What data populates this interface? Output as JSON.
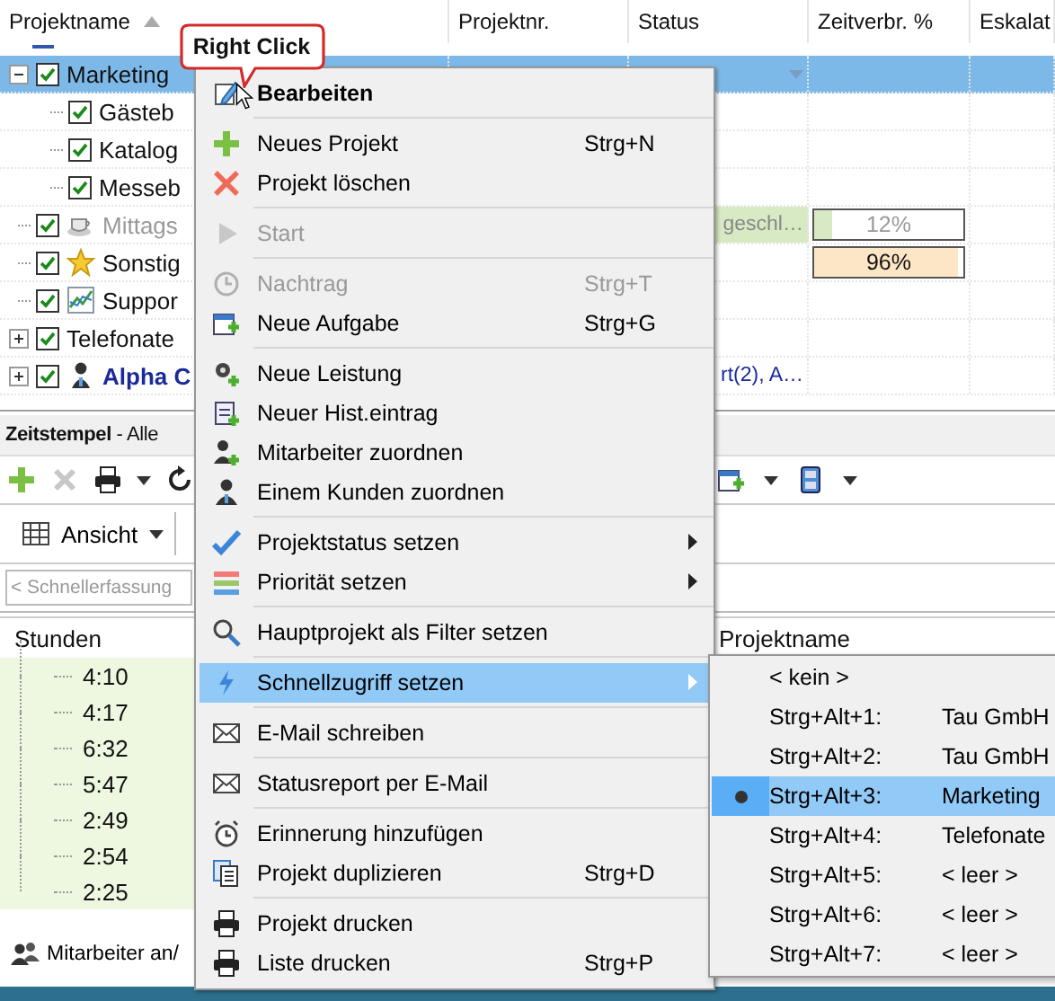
{
  "grid": {
    "columns": [
      "Projektname",
      "Projektnr.",
      "Status",
      "Zeitverbr. %",
      "Eskalat"
    ],
    "rows": [
      {
        "name": "Marketing",
        "checked": true,
        "selected": true,
        "disabled": false,
        "expanded": true,
        "children": [
          {
            "name": "Gästeb",
            "checked": true,
            "selected": false,
            "disabled": false
          },
          {
            "name": "Katalog",
            "checked": true,
            "selected": false,
            "disabled": false
          },
          {
            "name": "Messeb",
            "checked": true,
            "selected": false,
            "disabled": false
          }
        ]
      },
      {
        "name": "Mittags",
        "kind": "cup",
        "checked": true,
        "selected": false,
        "disabled": true,
        "status": {
          "text": "geschl…",
          "color": "#d8eac4"
        },
        "progress": {
          "level": 0.12,
          "reading": "12%",
          "color": "#d8eac4"
        }
      },
      {
        "name": "Sonstig",
        "kind": "star",
        "checked": true,
        "selected": false,
        "disabled": false,
        "progress": {
          "level": 0.96,
          "reading": "96%",
          "color": "#fde6c6"
        }
      },
      {
        "name": "Suppor",
        "kind": "chart",
        "checked": true,
        "selected": false,
        "disabled": false
      },
      {
        "name": "Telefonate",
        "checked": true,
        "selected": false,
        "disabled": false,
        "expanded": false
      },
      {
        "name": "Alpha C",
        "kind": "customer",
        "checked": true,
        "selected": false,
        "disabled": false,
        "expanded": false,
        "status": {
          "text": "rt(2), A…"
        }
      }
    ]
  },
  "timestamps": {
    "title": "**Zeitstempel** - Alle",
    "view_button": "Ansicht",
    "quick_entry": {
      "placeholder": "< Schnellerfassung"
    },
    "columns": [
      "Stunden",
      "Projektname"
    ],
    "hours": [
      "4:10",
      "4:17",
      "6:32",
      "5:47",
      "2:49",
      "2:54",
      "2:25"
    ],
    "assign_button": "Mitarbeiter an/"
  },
  "context_menu": {
    "items": [
      {
        "kind": "default",
        "label": "Bearbeiten",
        "disabled": false,
        "selected": false
      },
      {
        "kind": "separator"
      },
      {
        "kind": "item",
        "label": "Neues Projekt",
        "shortcut": "Strg+N",
        "disabled": false,
        "selected": false
      },
      {
        "kind": "item",
        "label": "Projekt löschen",
        "disabled": false,
        "selected": false
      },
      {
        "kind": "separator"
      },
      {
        "kind": "item",
        "label": "Start",
        "disabled": true,
        "selected": false
      },
      {
        "kind": "separator"
      },
      {
        "kind": "item",
        "label": "Nachtrag",
        "shortcut": "Strg+T",
        "disabled": true,
        "selected": false
      },
      {
        "kind": "item",
        "label": "Neue Aufgabe",
        "shortcut": "Strg+G",
        "disabled": false,
        "selected": false
      },
      {
        "kind": "separator"
      },
      {
        "kind": "item",
        "label": "Neue Leistung",
        "disabled": false,
        "selected": false
      },
      {
        "kind": "item",
        "label": "Neuer Hist.eintrag",
        "disabled": false,
        "selected": false
      },
      {
        "kind": "item",
        "label": "Mitarbeiter zuordnen",
        "disabled": false,
        "selected": false
      },
      {
        "kind": "item",
        "label": "Einem Kunden zuordnen",
        "disabled": false,
        "selected": false
      },
      {
        "kind": "separator"
      },
      {
        "kind": "submenu",
        "label": "Projektstatus setzen",
        "disabled": false,
        "selected": false
      },
      {
        "kind": "submenu",
        "label": "Priorität setzen",
        "disabled": false,
        "selected": false
      },
      {
        "kind": "separator"
      },
      {
        "kind": "item",
        "label": "Hauptprojekt als Filter setzen",
        "disabled": false,
        "selected": false
      },
      {
        "kind": "separator"
      },
      {
        "kind": "submenu",
        "label": "Schnellzugriff setzen",
        "disabled": false,
        "selected": true
      },
      {
        "kind": "separator"
      },
      {
        "kind": "item",
        "label": "E-Mail schreiben",
        "disabled": false,
        "selected": false
      },
      {
        "kind": "separator"
      },
      {
        "kind": "item",
        "label": "Statusreport per E-Mail",
        "disabled": false,
        "selected": false
      },
      {
        "kind": "separator"
      },
      {
        "kind": "item",
        "label": "Erinnerung hinzufügen",
        "disabled": false,
        "selected": false
      },
      {
        "kind": "item",
        "label": "Projekt duplizieren",
        "shortcut": "Strg+D",
        "disabled": false,
        "selected": false
      },
      {
        "kind": "separator"
      },
      {
        "kind": "item",
        "label": "Projekt drucken",
        "disabled": false,
        "selected": false
      },
      {
        "kind": "item",
        "label": "Liste drucken",
        "shortcut": "Strg+P",
        "disabled": false,
        "selected": false
      }
    ]
  },
  "quick_access_menu": {
    "items": [
      {
        "key": "< kein >",
        "selected": false
      },
      {
        "key": "Strg+Alt+1:",
        "value": "Tau GmbH",
        "selected": false
      },
      {
        "key": "Strg+Alt+2:",
        "value": "Tau GmbH",
        "selected": false
      },
      {
        "key": "Strg+Alt+3:",
        "value": "Marketing",
        "selected": true
      },
      {
        "key": "Strg+Alt+4:",
        "value": "Telefonate",
        "selected": false
      },
      {
        "key": "Strg+Alt+5:",
        "value": "< leer >",
        "selected": false
      },
      {
        "key": "Strg+Alt+6:",
        "value": "< leer >",
        "selected": false
      },
      {
        "key": "Strg+Alt+7:",
        "value": "< leer >",
        "selected": false
      }
    ]
  },
  "callout": {
    "text": "Right Click"
  }
}
